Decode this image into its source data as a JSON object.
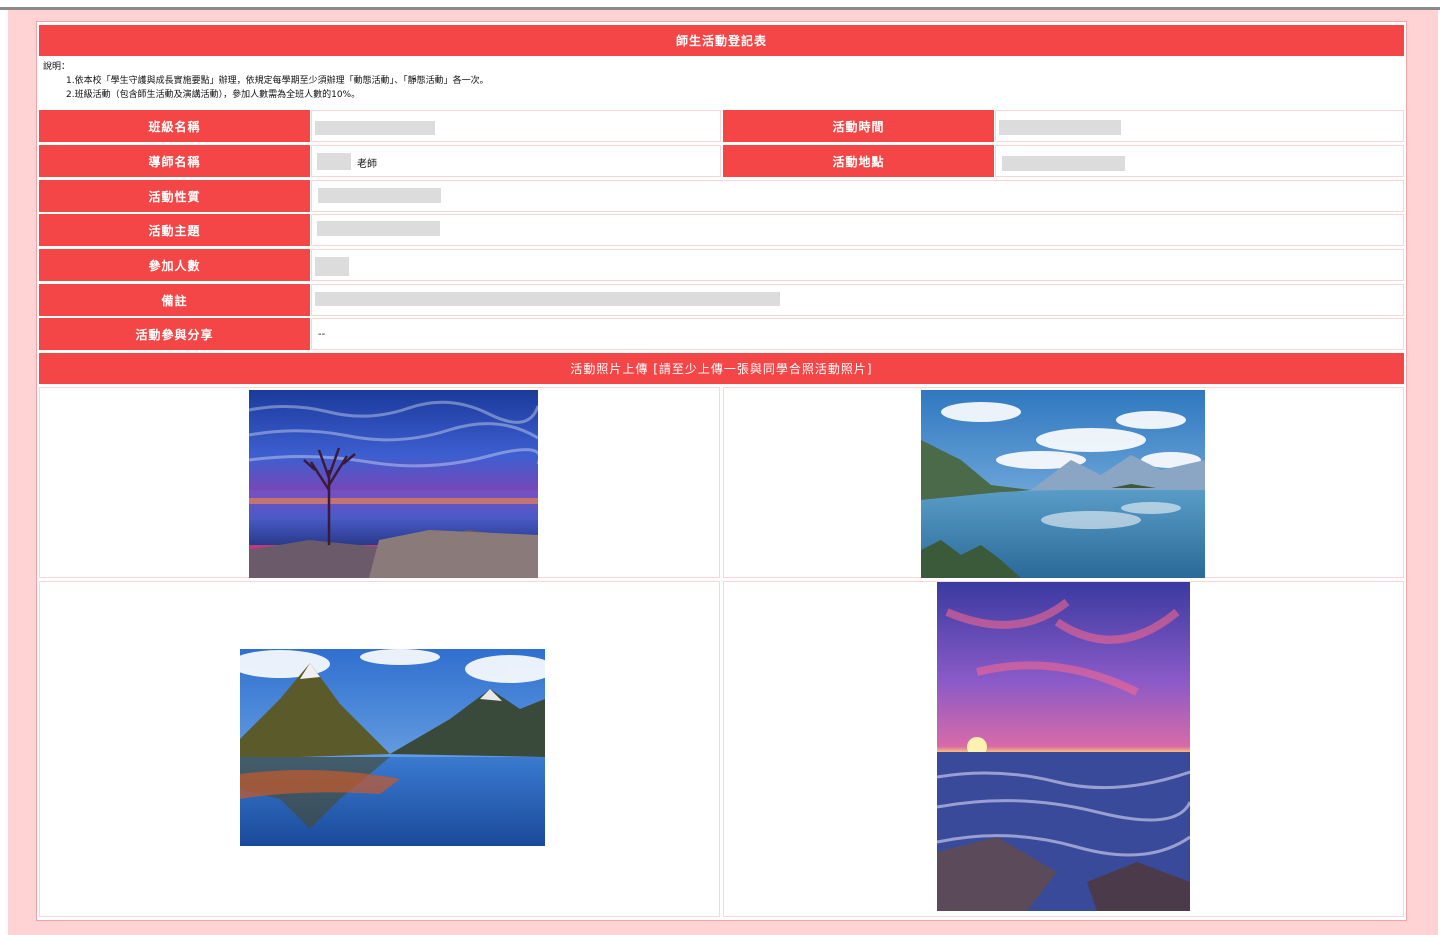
{
  "form": {
    "title": "師生活動登記表",
    "instructions": {
      "heading": "說明：",
      "line1": "1.依本校「學生守護與成長實施要點」辦理，依規定每學期至少須辦理「動態活動」、「靜態活動」各一次。",
      "line2": "2.班級活動（包含師生活動及演講活動），參加人數需為全班人數的10%。"
    },
    "fields": {
      "class_name_label": "班級名稱",
      "activity_time_label": "活動時間",
      "tutor_name_label": "導師名稱",
      "tutor_suffix": "老師",
      "activity_location_label": "活動地點",
      "activity_type_label": "活動性質",
      "activity_theme_label": "活動主題",
      "participants_label": "參加人數",
      "remarks_label": "備註",
      "sharing_label": "活動參與分享",
      "sharing_value": "--"
    },
    "photo_section": {
      "title": "活動照片上傳 [請至少上傳一張與同學合照活動照片]",
      "photos": [
        {
          "subject": "sunset-lake-with-tree"
        },
        {
          "subject": "mountain-lake-with-clouds"
        },
        {
          "subject": "mountain-fjord-reflection"
        },
        {
          "subject": "purple-sky-seascape"
        }
      ]
    }
  },
  "colors": {
    "accent_red": "#f44646",
    "page_pink": "#ffd3d4",
    "redacted_gray": "#dcdcdc"
  }
}
